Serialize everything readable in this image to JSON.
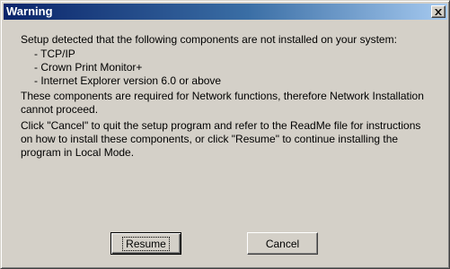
{
  "window": {
    "title": "Warning",
    "close_glyph": "✕"
  },
  "message": {
    "intro": "Setup detected that the following components are not installed on your system:",
    "components": [
      "- TCP/IP",
      "- Crown Print Monitor+",
      "- Internet Explorer version 6.0 or above"
    ],
    "requirement": "These components are required for Network functions, therefore Network Installation cannot proceed.",
    "instructions": "Click \"Cancel\" to quit the setup program and refer to the ReadMe file for instructions on how to install these components, or click \"Resume\" to continue installing the program in Local Mode."
  },
  "buttons": {
    "resume_label": "Resume",
    "cancel_label": "Cancel"
  },
  "colors": {
    "titlebar_start": "#0a246a",
    "titlebar_end": "#a6caf0",
    "face": "#d4d0c8"
  }
}
